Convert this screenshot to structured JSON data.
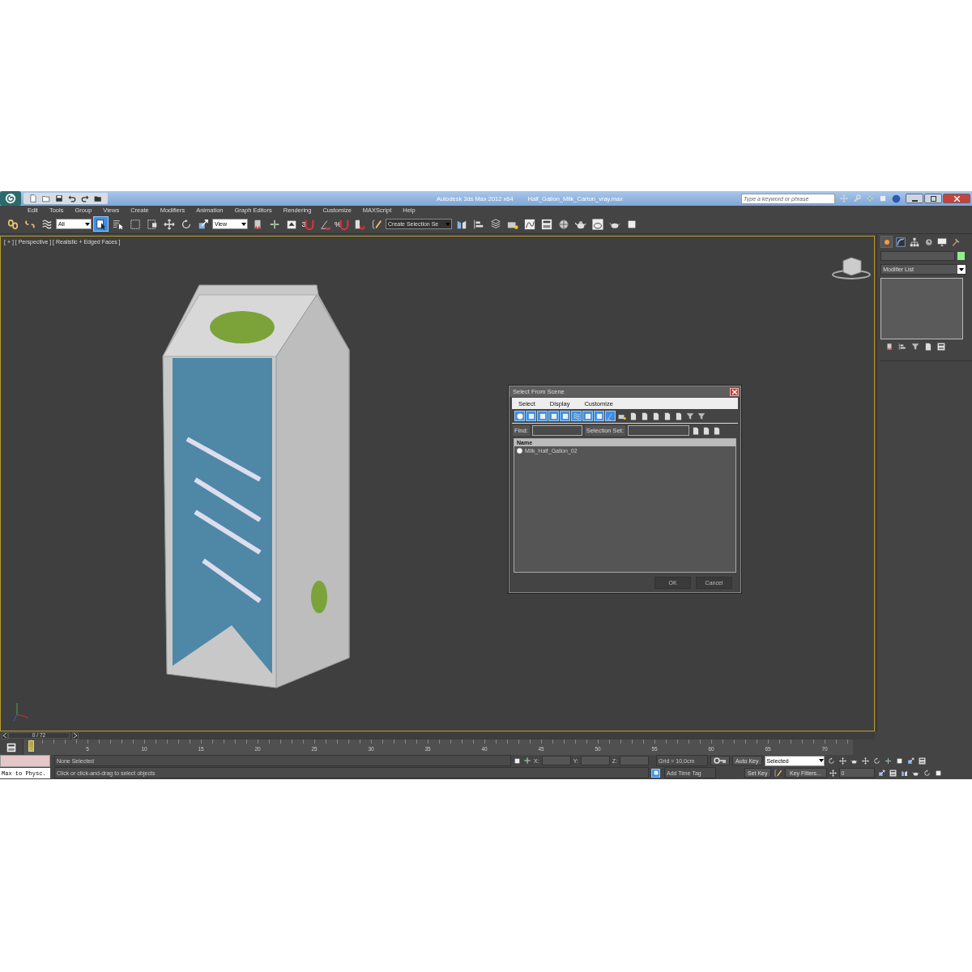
{
  "title_bar": {
    "app": "Autodesk 3ds Max  2012 x64",
    "file": "Half_Gallon_Milk_Carton_vray.max",
    "search": {
      "placeholder": "Type a keyword or phrase"
    }
  },
  "menu": [
    "Edit",
    "Tools",
    "Group",
    "Views",
    "Create",
    "Modifiers",
    "Animation",
    "Graph Editors",
    "Rendering",
    "Customize",
    "MAXScript",
    "Help"
  ],
  "main_toolbar": [
    {
      "kind": "button",
      "selected": false
    },
    {
      "kind": "button",
      "selected": false
    },
    {
      "kind": "button",
      "selected": false
    },
    {
      "kind": "dropdown",
      "value": "All"
    },
    {
      "kind": "button",
      "selected": true
    },
    {
      "kind": "button",
      "selected": false
    },
    {
      "kind": "button",
      "selected": false
    },
    {
      "kind": "button",
      "selected": false
    },
    {
      "kind": "button",
      "selected": false
    },
    {
      "kind": "button",
      "selected": false
    },
    {
      "kind": "button",
      "selected": false
    },
    {
      "kind": "dropdown",
      "value": "View"
    },
    {
      "kind": "button",
      "selected": false
    },
    {
      "kind": "button",
      "selected": false
    },
    {
      "kind": "button",
      "selected": false
    },
    {
      "kind": "button",
      "selected": false,
      "glyph": "3"
    },
    {
      "kind": "button",
      "selected": false
    },
    {
      "kind": "button",
      "selected": false,
      "glyph": "%"
    },
    {
      "kind": "button",
      "selected": false
    },
    {
      "kind": "button",
      "selected": false
    },
    {
      "kind": "dropdown",
      "value": "Create Selection Se"
    },
    {
      "kind": "button",
      "selected": false
    },
    {
      "kind": "button",
      "selected": false
    },
    {
      "kind": "button",
      "selected": false
    },
    {
      "kind": "button",
      "selected": false
    },
    {
      "kind": "button",
      "selected": false
    },
    {
      "kind": "button",
      "selected": false
    },
    {
      "kind": "button",
      "selected": false
    },
    {
      "kind": "button",
      "selected": false
    },
    {
      "kind": "button",
      "selected": false
    },
    {
      "kind": "button",
      "selected": false
    },
    {
      "kind": "button",
      "selected": false
    }
  ],
  "viewport": {
    "label": "[ + ] [ Perspective ] [ Realistic + Edged Faces ]"
  },
  "dialog": {
    "title": "Select From Scene",
    "menu": [
      "Select",
      "Display",
      "Customize"
    ],
    "toggles": [
      {
        "on": true
      },
      {
        "on": true
      },
      {
        "on": true
      },
      {
        "on": true
      },
      {
        "on": true
      },
      {
        "on": true
      },
      {
        "on": true
      },
      {
        "on": true
      },
      {
        "on": true
      },
      {
        "on": false
      },
      {
        "on": false
      },
      {
        "on": false
      },
      {
        "on": false
      },
      {
        "on": false
      },
      {
        "on": false
      },
      {
        "on": false
      },
      {
        "on": false
      }
    ],
    "find_label": "Find:",
    "selection_set_label": "Selection Set:",
    "column": "Name",
    "rows": [
      {
        "name": "Milk_Half_Gallon_02",
        "selected": false
      }
    ],
    "buttons": [
      "OK",
      "Cancel"
    ]
  },
  "command_panel": {
    "tabs": [
      {
        "selected": true
      },
      {
        "selected": false
      },
      {
        "selected": false
      },
      {
        "selected": false
      },
      {
        "selected": false
      },
      {
        "selected": false
      }
    ],
    "modifier_list": "Modifier List"
  },
  "time_slider": {
    "label": "0 / 72",
    "level": 0
  },
  "track_labels": [
    "0",
    "5",
    "10",
    "15",
    "20",
    "25",
    "30",
    "35",
    "40",
    "45",
    "50",
    "55",
    "60",
    "65",
    "70"
  ],
  "status": {
    "script_listener": "Max to Physc.",
    "selection": "None Selected",
    "prompt": "Click or click-and-drag to select objects",
    "x_label": "X:",
    "y_label": "Y:",
    "z_label": "Z:",
    "grid": "Grid = 10,0cm",
    "time_tag": "Add Time Tag",
    "auto_key": "Auto Key",
    "key_mode": "Selected",
    "set_key": "Set Key",
    "key_filters": "Key Filters...",
    "frame": "0"
  }
}
